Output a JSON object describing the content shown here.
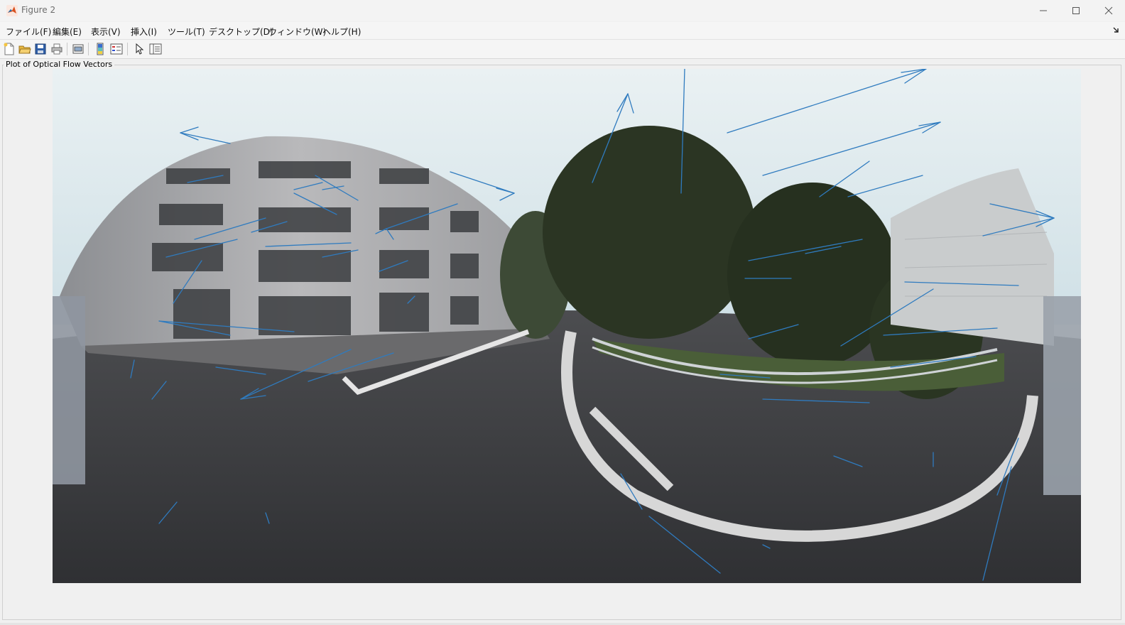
{
  "window": {
    "title": "Figure 2"
  },
  "menu": {
    "items": [
      "ファイル(F)",
      "編集(E)",
      "表示(V)",
      "挿入(I)",
      "ツール(T)",
      "デスクトップ(D)",
      "ウィンドウ(W)",
      "ヘルプ(H)"
    ]
  },
  "toolbar": {
    "icons": [
      "new-figure-icon",
      "open-file-icon",
      "save-icon",
      "print-icon",
      "print-preview-icon",
      "colorbar-icon",
      "legend-icon",
      "pointer-icon",
      "property-inspector-icon"
    ]
  },
  "panel": {
    "title": "Plot of Optical Flow Vectors"
  },
  "colors": {
    "vector": "#2f7bbf",
    "titlebar_text": "#6d6d6d"
  }
}
